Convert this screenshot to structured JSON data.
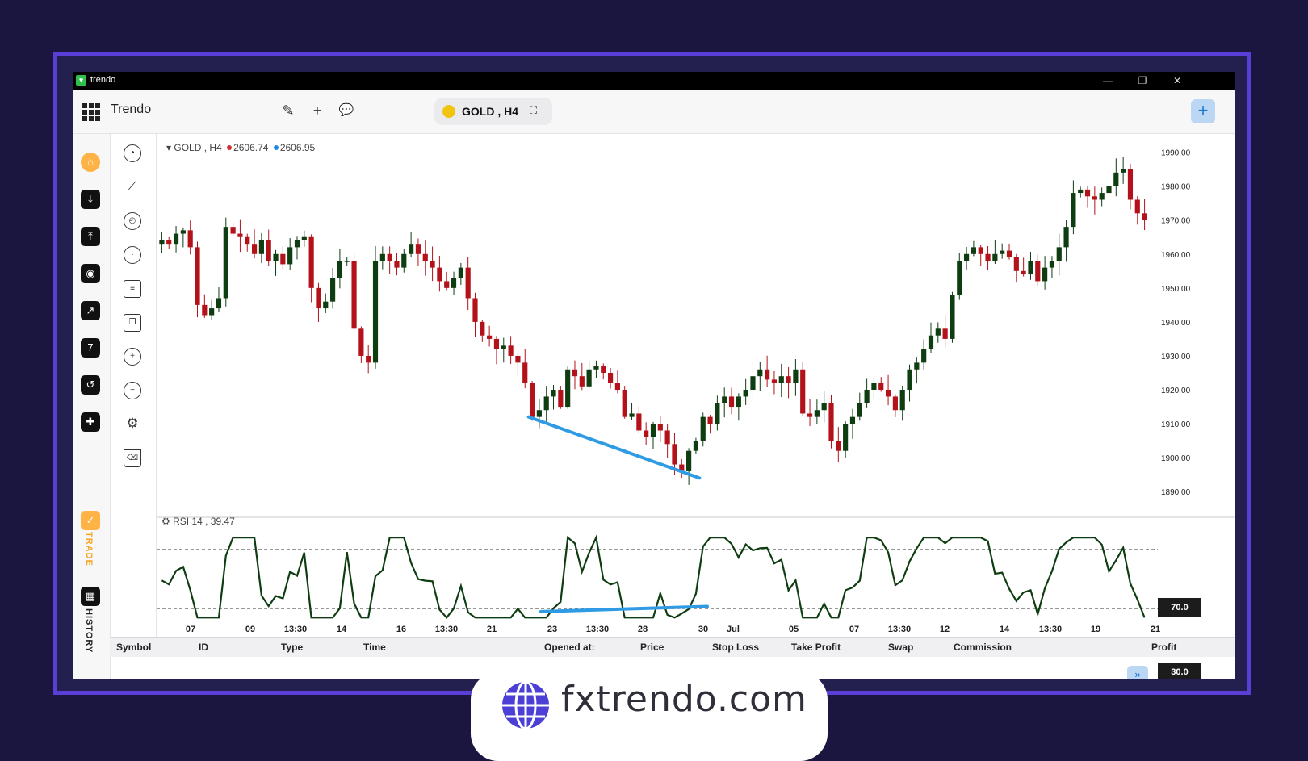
{
  "window": {
    "app_label": "trendo",
    "minimize": "—",
    "restore": "❐",
    "close": "✕"
  },
  "toolbar": {
    "title": "Trendo",
    "pencil_icon": "✎",
    "add_icon": "+",
    "chat_icon": "💬",
    "symbol": "GOLD , H4",
    "expand_icon": "⛶",
    "plus_button": "+"
  },
  "sidebar": {
    "trade_label": "TRADE",
    "history_label": "HISTORY",
    "seven": "7"
  },
  "chart": {
    "legend_symbol": "GOLD , H4",
    "bid": "2606.74",
    "ask": "2606.95",
    "bid_color": "#d32f2f",
    "ask_color": "#1e88e5",
    "rsi_label": "RSI 14 , 39.47",
    "rsi_upper": "70.0",
    "rsi_lower": "30.0",
    "up_color": "#0f3d12",
    "down_color": "#b3121b",
    "trendline_color": "#2f9be4"
  },
  "chart_data": {
    "type": "candlestick",
    "y_ticks": [
      "1990.00",
      "1980.00",
      "1970.00",
      "1960.00",
      "1950.00",
      "1940.00",
      "1930.00",
      "1920.00",
      "1910.00",
      "1900.00",
      "1890.00"
    ],
    "ylim": [
      1886,
      1993
    ],
    "x_ticks": [
      "07",
      "09",
      "13:30",
      "14",
      "16",
      "13:30",
      "21",
      "23",
      "13:30",
      "28",
      "30",
      "Jul",
      "05",
      "07",
      "13:30",
      "12",
      "14",
      "13:30",
      "19",
      "21"
    ],
    "close_path": [
      1964,
      1963,
      1966,
      1967,
      1962,
      1945,
      1942,
      1944,
      1947,
      1968,
      1966,
      1965,
      1963,
      1960,
      1964,
      1958,
      1960,
      1957,
      1962,
      1964,
      1965,
      1950,
      1944,
      1946,
      1953,
      1958,
      1958,
      1938,
      1930,
      1928,
      1958,
      1960,
      1958,
      1956,
      1960,
      1963,
      1960,
      1958,
      1956,
      1952,
      1950,
      1953,
      1956,
      1947,
      1940,
      1936,
      1935,
      1932,
      1933,
      1930,
      1928,
      1922,
      1912,
      1914,
      1918,
      1920,
      1915,
      1926,
      1924,
      1921,
      1926,
      1927,
      1925,
      1922,
      1920,
      1912,
      1913,
      1908,
      1906,
      1910,
      1908,
      1904,
      1898,
      1896,
      1902,
      1905,
      1912,
      1910,
      1916,
      1918,
      1915,
      1918,
      1920,
      1924,
      1926,
      1923,
      1922,
      1924,
      1922,
      1926,
      1913,
      1912,
      1914,
      1916,
      1905,
      1902,
      1910,
      1912,
      1916,
      1920,
      1922,
      1920,
      1918,
      1914,
      1920,
      1926,
      1928,
      1932,
      1936,
      1938,
      1935,
      1948,
      1958,
      1960,
      1962,
      1960,
      1958,
      1960,
      1961,
      1959,
      1955,
      1954,
      1958,
      1952,
      1956,
      1958,
      1962,
      1968,
      1978,
      1979,
      1977,
      1976,
      1978,
      1980,
      1984,
      1985,
      1976,
      1972,
      1970
    ]
  },
  "table": {
    "columns": [
      "Symbol",
      "ID",
      "Type",
      "Time",
      "Opened at:",
      "Price",
      "Stop Loss",
      "Take Profit",
      "Swap",
      "Commission",
      "Profit"
    ]
  },
  "banner": {
    "domain": "fxtrendo.com"
  }
}
